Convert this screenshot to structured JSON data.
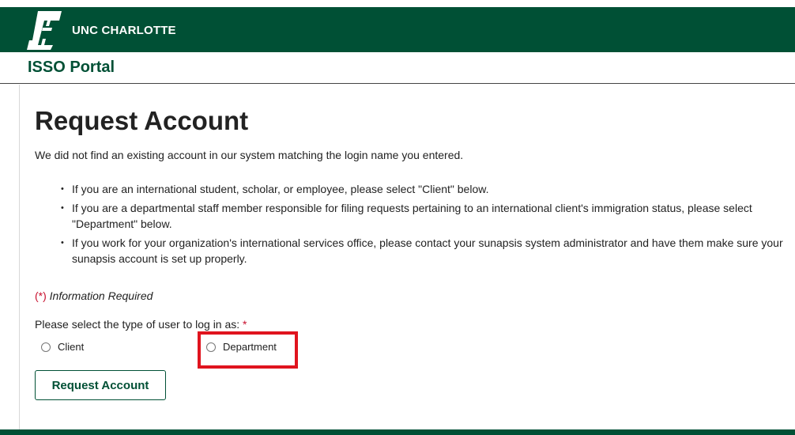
{
  "header": {
    "brand": "UNC CHARLOTTE",
    "portal_title": "ISSO Portal"
  },
  "main": {
    "title": "Request Account",
    "intro": "We did not find an existing account in our system matching the login name you entered.",
    "bullets": [
      "If you are an international student, scholar, or employee, please select \"Client\" below.",
      "If you are a departmental staff member responsible for filing requests pertaining to an international client's immigration status, please select \"Department\" below.",
      "If you work for your organization's international services office, please contact your sunapsis system administrator and have them make sure your sunapsis account is set up properly."
    ],
    "required_star": "(*)",
    "required_text": "Information Required",
    "select_prompt": "Please select the type of user to log in as:",
    "select_star": "*",
    "options": [
      {
        "label": "Client"
      },
      {
        "label": "Department"
      }
    ],
    "submit_label": "Request Account"
  },
  "colors": {
    "brand_green": "#005035",
    "highlight_red": "#e0141e",
    "required_red": "#c8102e"
  },
  "icons": {
    "logo": "unc-charlotte-c-logo"
  }
}
